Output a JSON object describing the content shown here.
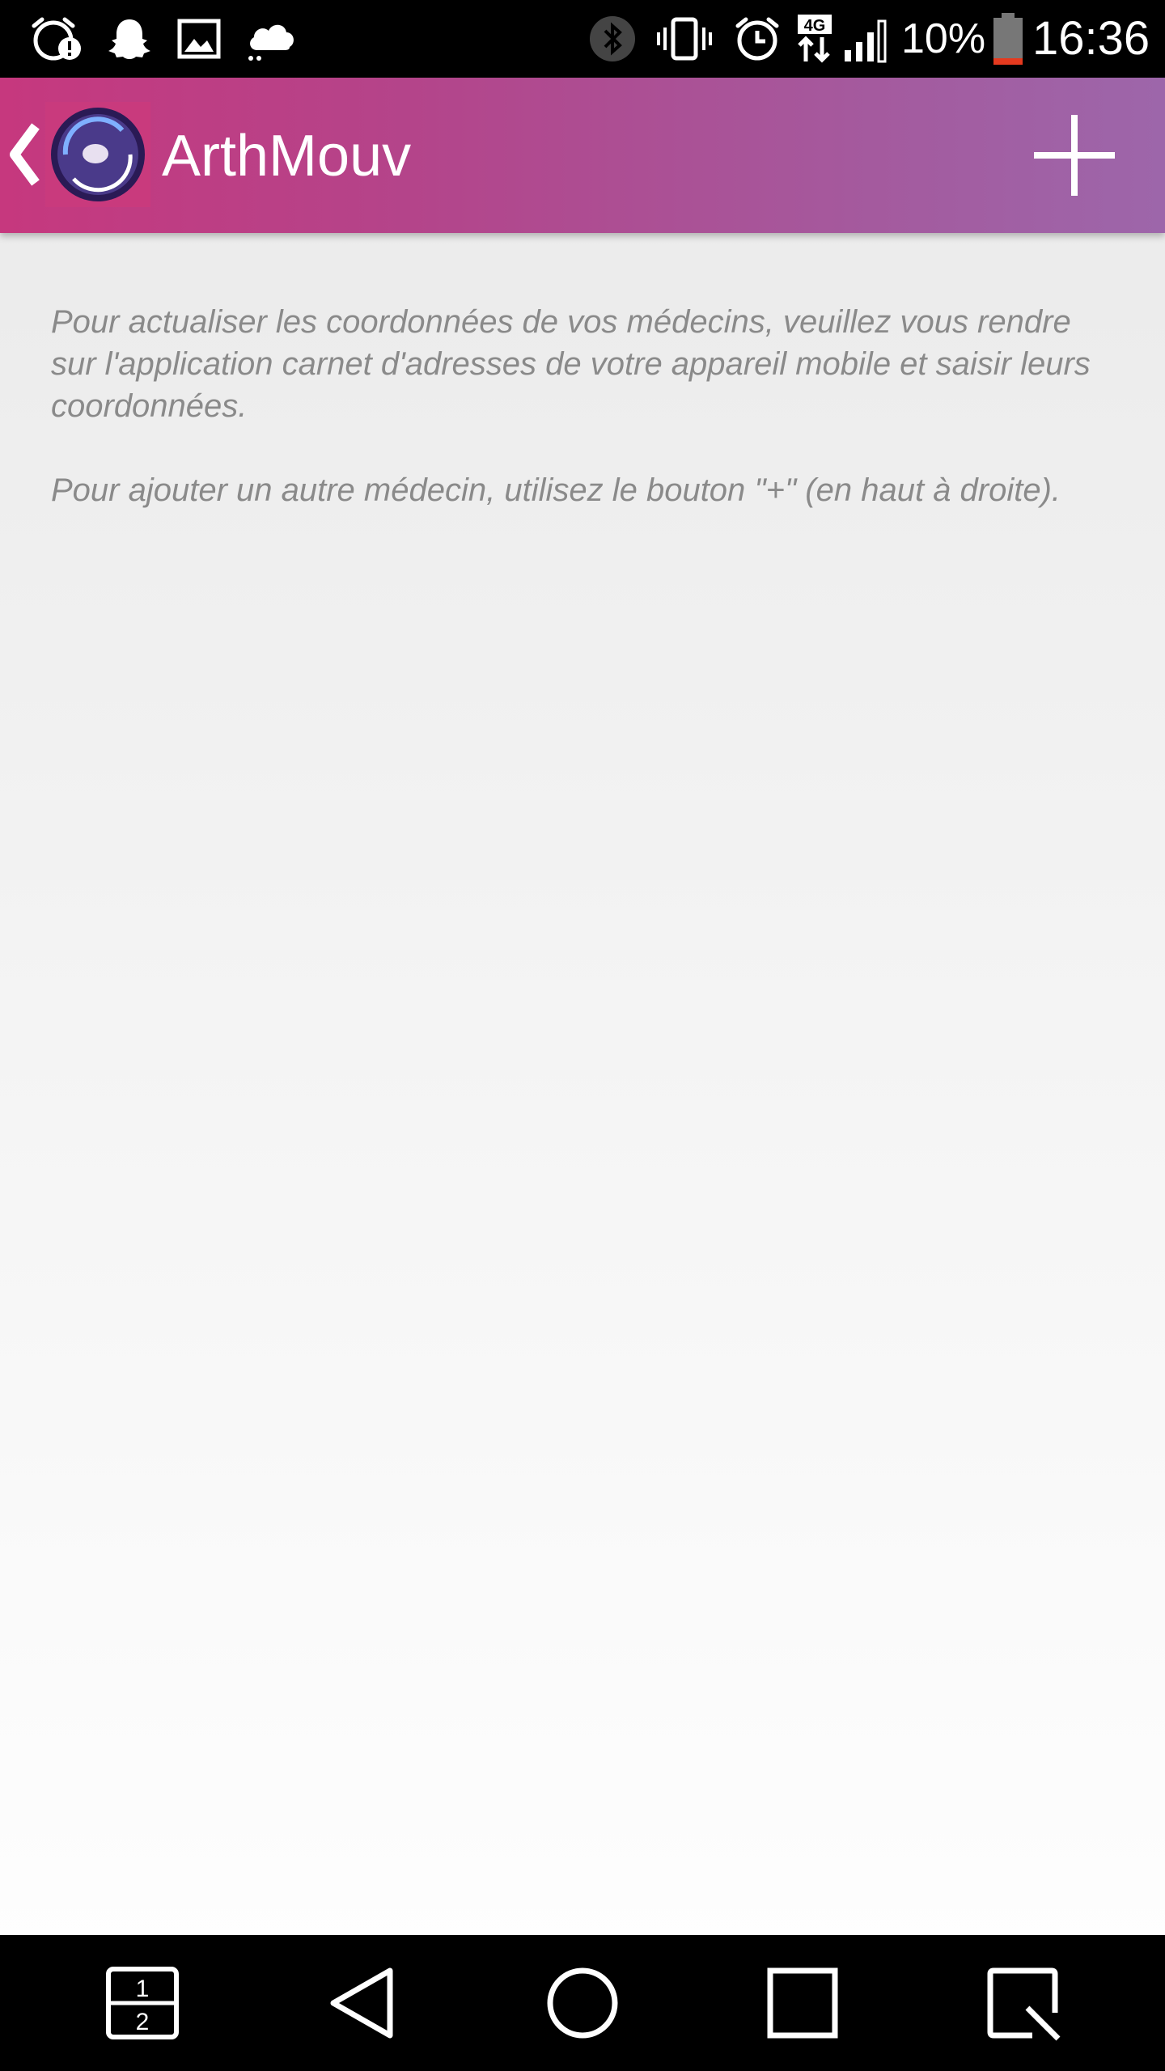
{
  "status_bar": {
    "icons": [
      "alarm-alert-icon",
      "snapchat-ghost-icon",
      "gallery-icon",
      "cloud-icon",
      "bluetooth-icon",
      "vibrate-icon",
      "alarm-clock-icon",
      "4g-data-icon",
      "signal-icon",
      "battery-icon"
    ],
    "network_label": "4G",
    "battery_percent": "10%",
    "time": "16:36"
  },
  "app_bar": {
    "title": "ArthMouv",
    "back_icon": "chevron-left-icon",
    "logo_icon": "app-logo-icon",
    "add_icon": "plus-icon",
    "gradient_start": "#c6387e",
    "gradient_end": "#9d66aa"
  },
  "content": {
    "paragraph_1": "Pour actualiser les coordonnées de vos médecins, veuillez vous rendre sur l'application carnet d'adresses de votre appareil mobile et saisir leurs coordonnées.",
    "paragraph_2": "Pour ajouter un autre médecin, utilisez le bouton \"+\" (en haut à droite)."
  },
  "nav_bar": {
    "dual_window_label_top": "1",
    "dual_window_label_bottom": "2",
    "buttons": [
      "dual-window-icon",
      "back-triangle-icon",
      "home-circle-icon",
      "recents-square-icon",
      "qslide-icon"
    ]
  }
}
